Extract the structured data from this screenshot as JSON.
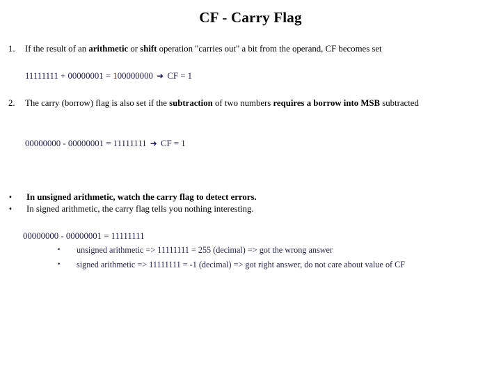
{
  "slide": {
    "title": "CF - Carry Flag",
    "background_color": "#ffffff",
    "text_color": "#000000",
    "equation_color": "#1f1f4a",
    "highlight_color": "#8b1a10"
  },
  "numbered_items": [
    {
      "marker": "1.",
      "parts": [
        {
          "text": "If the result of an ",
          "bold": false
        },
        {
          "text": "arithmetic",
          "bold": true
        },
        {
          "text": " or ",
          "bold": false
        },
        {
          "text": "shift",
          "bold": true
        },
        {
          "text": " operation \"carries out\" a bit from the operand, CF becomes set",
          "bold": false
        }
      ],
      "plain": "If the result of an arithmetic or shift operation \"carries out\" a bit from the operand, CF becomes set"
    },
    {
      "marker": "2.",
      "parts": [
        {
          "text": "The carry (borrow) flag is also set if the ",
          "bold": false
        },
        {
          "text": "subtraction",
          "bold": true
        },
        {
          "text": " of two numbers ",
          "bold": false
        },
        {
          "text": "requires a borrow into MSB",
          "bold": true
        },
        {
          "text": " subtracted",
          "bold": false
        }
      ],
      "plain": "The carry (borrow) flag is also set if the subtraction of two numbers requires a borrow into MSB subtracted"
    }
  ],
  "equations": [
    {
      "prefix": "11111111 + 00000001 = ",
      "highlight": "1",
      "middle": "00000000 ",
      "arrow": "➜",
      "suffix": " CF = 1",
      "plain": "11111111 + 00000001 = 100000000 ➜ CF = 1"
    },
    {
      "prefix": "00000000 - 00000001 = 11111111 ",
      "highlight": "",
      "middle": "",
      "arrow": "➜",
      "suffix": " CF = 1",
      "plain": "00000000 - 00000001 = 11111111 ➜ CF = 1"
    }
  ],
  "bullets": [
    {
      "dot": "•",
      "text": "In unsigned arithmetic, watch the carry flag to detect errors.",
      "bold": true
    },
    {
      "dot": "•",
      "text": "In signed arithmetic, the carry flag tells you nothing interesting.",
      "bold": false
    }
  ],
  "example": {
    "equation": "00000000 - 00000001 = 11111111",
    "sub_bullets": [
      {
        "dot": "•",
        "text": "unsigned arithmetic => 11111111  = 255 (decimal) => got the wrong answer"
      },
      {
        "dot": "•",
        "text": "signed arithmetic => 11111111 = -1 (decimal) => got right answer, do not care about value of CF"
      }
    ]
  }
}
